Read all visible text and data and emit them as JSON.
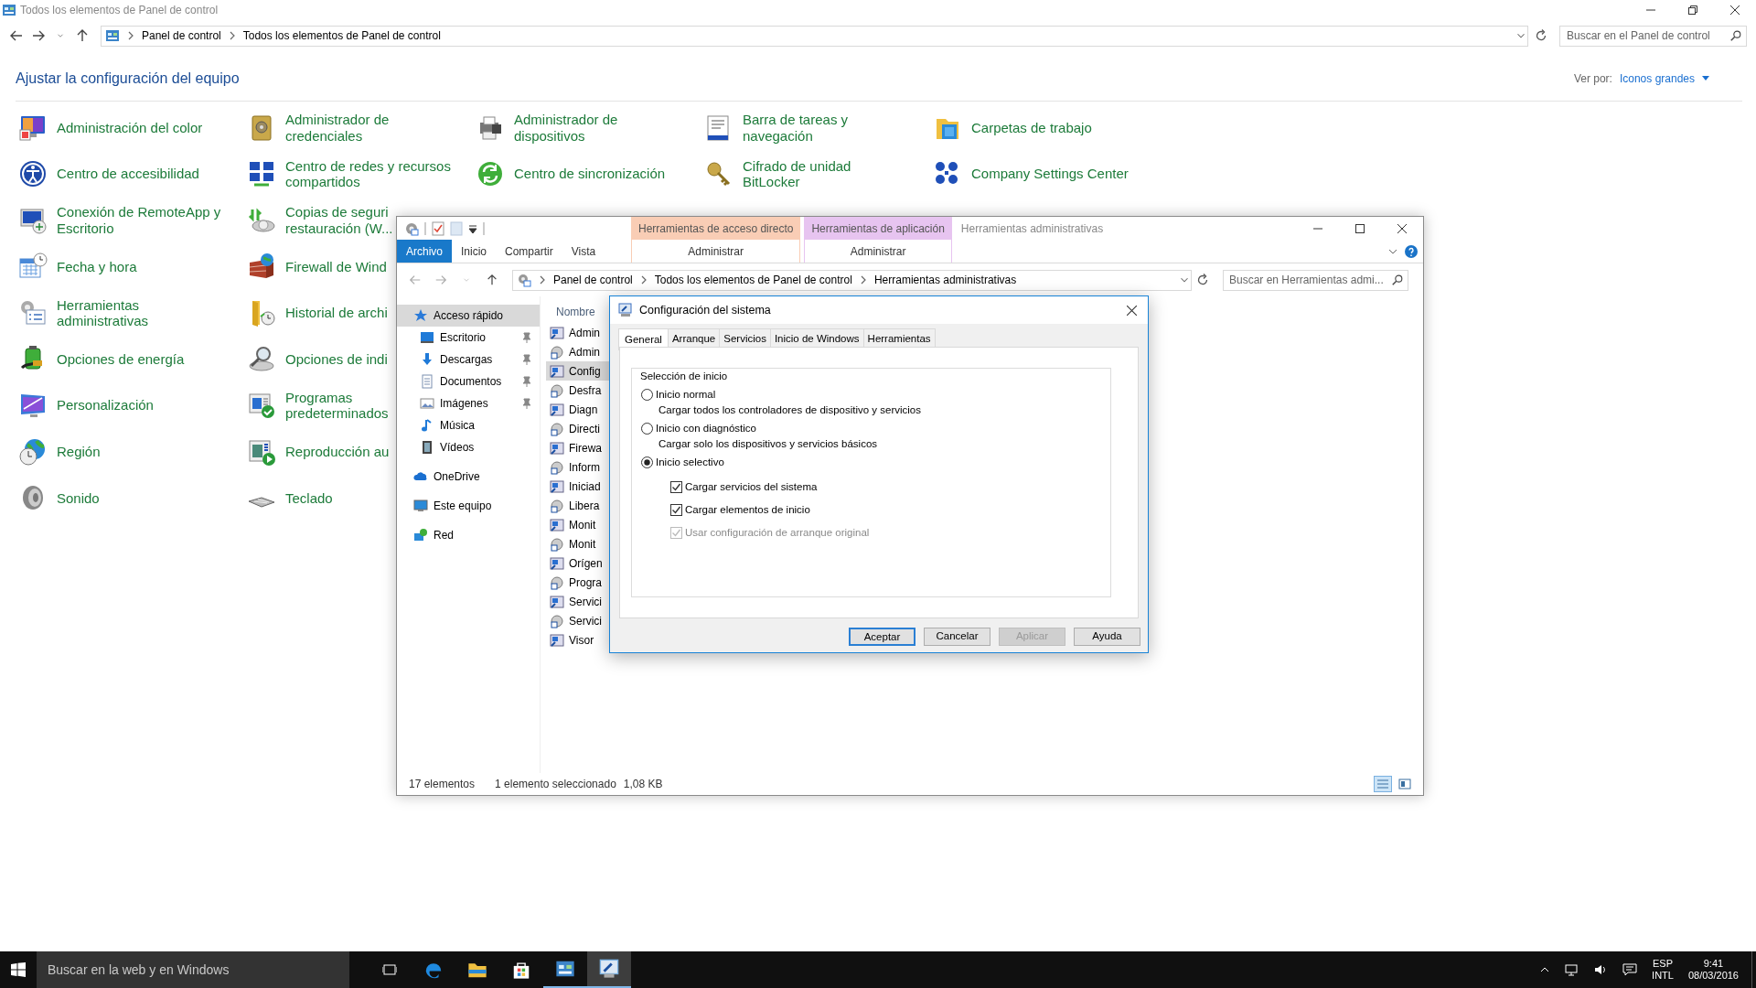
{
  "window": {
    "title": "Todos los elementos de Panel de control"
  },
  "address_bar": {
    "crumbs": [
      "Panel de control",
      "Todos los elementos de Panel de control"
    ],
    "search_placeholder": "Buscar en el Panel de control"
  },
  "header": {
    "title": "Ajustar la configuración del equipo",
    "view_label": "Ver por:",
    "view_value": "Iconos grandes"
  },
  "columns": [
    {
      "items": [
        {
          "lines": [
            "Administración del color"
          ]
        },
        {
          "lines": [
            "Centro de accesibilidad"
          ]
        },
        {
          "lines": [
            "Conexión de RemoteApp y",
            "Escritorio"
          ]
        },
        {
          "lines": [
            "Fecha y hora"
          ]
        },
        {
          "lines": [
            "Herramientas",
            "administrativas"
          ]
        },
        {
          "lines": [
            "Opciones de energía"
          ]
        },
        {
          "lines": [
            "Personalización"
          ]
        },
        {
          "lines": [
            "Región"
          ]
        },
        {
          "lines": [
            "Sonido"
          ]
        }
      ]
    },
    {
      "items": [
        {
          "lines": [
            "Administrador de",
            "credenciales"
          ]
        },
        {
          "lines": [
            "Centro de redes y recursos",
            "compartidos"
          ]
        },
        {
          "lines": [
            "Copias de seguri",
            "restauración (W..."
          ]
        },
        {
          "lines": [
            "Firewall de Wind"
          ]
        },
        {
          "lines": [
            "Historial de archi"
          ]
        },
        {
          "lines": [
            "Opciones de indi"
          ]
        },
        {
          "lines": [
            "Programas",
            "predeterminados"
          ]
        },
        {
          "lines": [
            "Reproducción au"
          ]
        },
        {
          "lines": [
            "Teclado"
          ]
        }
      ]
    },
    {
      "items": [
        {
          "lines": [
            "Administrador de",
            "dispositivos"
          ]
        },
        {
          "lines": [
            "Centro de sincronización"
          ]
        }
      ]
    },
    {
      "items": [
        {
          "lines": [
            "Barra de tareas y",
            "navegación"
          ]
        },
        {
          "lines": [
            "Cifrado de unidad",
            "BitLocker"
          ]
        }
      ]
    },
    {
      "items": [
        {
          "lines": [
            "Carpetas de trabajo"
          ]
        },
        {
          "lines": [
            "Company Settings Center"
          ]
        }
      ]
    }
  ],
  "explorer": {
    "title": "Herramientas administrativas",
    "ribbon_tabs": [
      {
        "label": "Archivo",
        "kind": "file"
      },
      {
        "label": "Inicio",
        "kind": "tab"
      },
      {
        "label": "Compartir",
        "kind": "tab"
      },
      {
        "label": "Vista",
        "kind": "tab"
      }
    ],
    "context_groups": [
      {
        "label": "Herramientas de acceso directo",
        "color": "#f9cdb5",
        "tab": "Administrar"
      },
      {
        "label": "Herramientas de aplicación",
        "color": "#e7c4f0",
        "tab": "Administrar"
      }
    ],
    "crumbs": [
      "Panel de control",
      "Todos los elementos de Panel de control",
      "Herramientas administrativas"
    ],
    "search_placeholder": "Buscar en Herramientas admi...",
    "nav": [
      {
        "label": "Acceso rápido",
        "selected": true,
        "children": [
          {
            "label": "Escritorio",
            "selected": false,
            "pinned": true
          },
          {
            "label": "Descargas",
            "selected": false,
            "pinned": true
          },
          {
            "label": "Documentos",
            "selected": false,
            "pinned": true
          },
          {
            "label": "Imágenes",
            "selected": false,
            "pinned": true
          },
          {
            "label": "Música",
            "selected": false,
            "pinned": false
          },
          {
            "label": "Vídeos",
            "selected": false,
            "pinned": false
          }
        ]
      },
      {
        "label": "OneDrive",
        "selected": false
      },
      {
        "label": "Este equipo",
        "selected": false
      },
      {
        "label": "Red",
        "selected": false
      }
    ],
    "column_header": "Nombre",
    "files": [
      {
        "name": "Admin",
        "selected": false
      },
      {
        "name": "Admin",
        "selected": false
      },
      {
        "name": "Config",
        "selected": true
      },
      {
        "name": "Desfra",
        "selected": false
      },
      {
        "name": "Diagn",
        "selected": false
      },
      {
        "name": "Directi",
        "selected": false
      },
      {
        "name": "Firewa",
        "selected": false
      },
      {
        "name": "Inform",
        "selected": false
      },
      {
        "name": "Iniciad",
        "selected": false
      },
      {
        "name": "Libera",
        "selected": false
      },
      {
        "name": "Monit",
        "selected": false
      },
      {
        "name": "Monit",
        "selected": false
      },
      {
        "name": "Orígen",
        "selected": false
      },
      {
        "name": "Progra",
        "selected": false
      },
      {
        "name": "Servici",
        "selected": false
      },
      {
        "name": "Servici",
        "selected": false
      },
      {
        "name": "Visor",
        "selected": false
      }
    ],
    "status": {
      "count": "17 elementos",
      "selection": "1 elemento seleccionado",
      "size": "1,08 KB"
    }
  },
  "dialog": {
    "title": "Configuración del sistema",
    "tabs": [
      {
        "label": "General",
        "selected": true
      },
      {
        "label": "Arranque",
        "selected": false
      },
      {
        "label": "Servicios",
        "selected": false
      },
      {
        "label": "Inicio de Windows",
        "selected": false
      },
      {
        "label": "Herramientas",
        "selected": false
      }
    ],
    "group": "Selección de inicio",
    "modes": [
      {
        "label": "Inicio normal",
        "selected": false,
        "description": "Cargar todos los controladores de dispositivo y servicios"
      },
      {
        "label": "Inicio con diagnóstico",
        "selected": false,
        "description": "Cargar solo los dispositivos y servicios básicos"
      },
      {
        "label": "Inicio selectivo",
        "selected": true
      }
    ],
    "options": [
      {
        "label": "Cargar servicios del sistema",
        "checked": true,
        "disabled": false
      },
      {
        "label": "Cargar elementos de inicio",
        "checked": true,
        "disabled": false
      },
      {
        "label": "Usar configuración de arranque original",
        "checked": true,
        "disabled": true
      }
    ],
    "buttons": [
      {
        "label": "Aceptar",
        "default": true,
        "disabled": false
      },
      {
        "label": "Cancelar",
        "default": false,
        "disabled": false
      },
      {
        "label": "Aplicar",
        "default": false,
        "disabled": true
      },
      {
        "label": "Ayuda",
        "default": false,
        "disabled": false
      }
    ]
  },
  "taskbar": {
    "search_placeholder": "Buscar en la web y en Windows",
    "apps": [
      {
        "active": false,
        "focused": false
      },
      {
        "active": false,
        "focused": false
      },
      {
        "active": false,
        "focused": false
      },
      {
        "active": false,
        "focused": false
      },
      {
        "active": true,
        "focused": false
      },
      {
        "active": true,
        "focused": true
      }
    ],
    "language": "ESP",
    "layout": "INTL",
    "time": "9:41",
    "date": "08/03/2016"
  }
}
